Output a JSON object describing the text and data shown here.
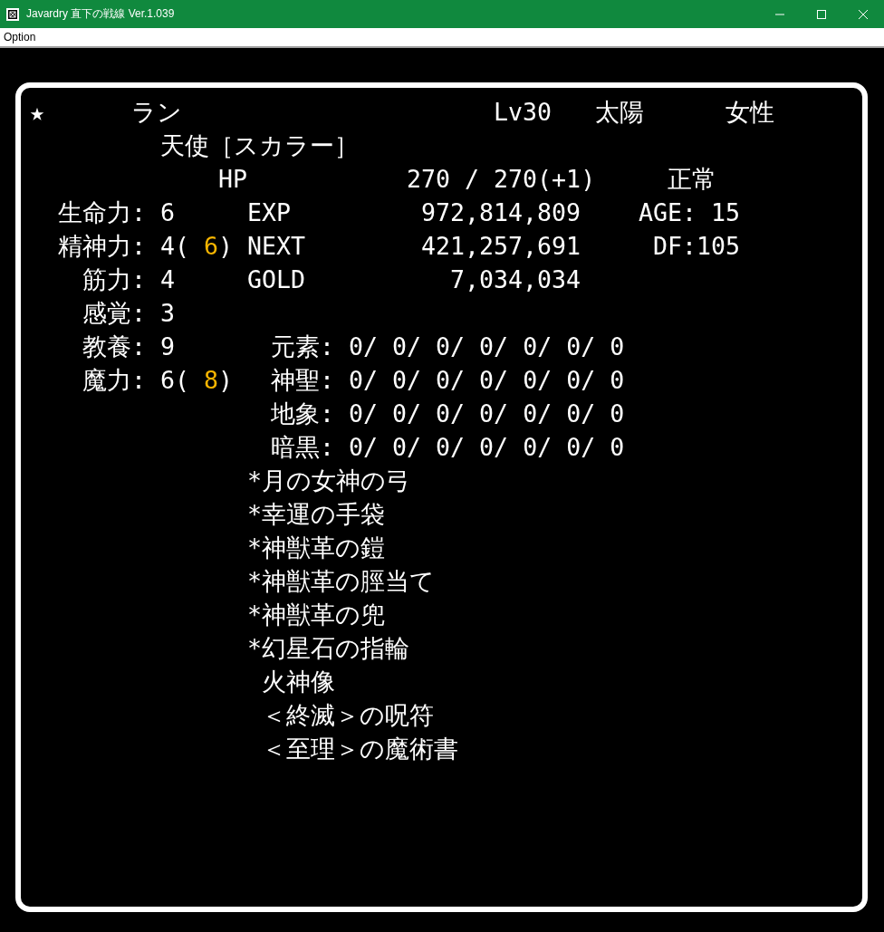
{
  "window": {
    "title": "Javardry 直下の戦線 Ver.1.039"
  },
  "menu": [
    "Option"
  ],
  "character": {
    "mark": "★",
    "name": "ラン",
    "level": "Lv30",
    "alignment": "太陽",
    "sex": "女性",
    "race_class": "天使［スカラー］"
  },
  "hp": {
    "label": "HP",
    "value": "270 / 270(+1)",
    "condition": "正常"
  },
  "stats": [
    {
      "label": "生命力:",
      "parts": [
        {
          "text": "6",
          "highlight": false
        }
      ]
    },
    {
      "label": "精神力:",
      "parts": [
        {
          "text": "4( ",
          "highlight": false
        },
        {
          "text": "6",
          "highlight": true
        },
        {
          "text": ")",
          "highlight": false
        }
      ]
    },
    {
      "label": "筋力:",
      "parts": [
        {
          "text": "4",
          "highlight": false
        }
      ]
    },
    {
      "label": "感覚:",
      "parts": [
        {
          "text": "3",
          "highlight": false
        }
      ]
    },
    {
      "label": "教養:",
      "parts": [
        {
          "text": "9",
          "highlight": false
        }
      ]
    },
    {
      "label": "魔力:",
      "parts": [
        {
          "text": "6( ",
          "highlight": false
        },
        {
          "text": "8",
          "highlight": true
        },
        {
          "text": ")",
          "highlight": false
        }
      ]
    }
  ],
  "records": [
    {
      "label": "EXP",
      "value": "972,814,809"
    },
    {
      "label": "NEXT",
      "value": "421,257,691"
    },
    {
      "label": "GOLD",
      "value": "7,034,034"
    }
  ],
  "age": "AGE: 15",
  "df": "DF:105",
  "resistances": [
    {
      "label": "元素:",
      "values": "0/ 0/ 0/ 0/ 0/ 0/ 0"
    },
    {
      "label": "神聖:",
      "values": "0/ 0/ 0/ 0/ 0/ 0/ 0"
    },
    {
      "label": "地象:",
      "values": "0/ 0/ 0/ 0/ 0/ 0/ 0"
    },
    {
      "label": "暗黒:",
      "values": "0/ 0/ 0/ 0/ 0/ 0/ 0"
    }
  ],
  "items": [
    {
      "mark": "*",
      "name": "月の女神の弓"
    },
    {
      "mark": "*",
      "name": "幸運の手袋"
    },
    {
      "mark": "*",
      "name": "神獣革の鎧"
    },
    {
      "mark": "*",
      "name": "神獣革の脛当て"
    },
    {
      "mark": "*",
      "name": "神獣革の兜"
    },
    {
      "mark": "*",
      "name": "幻星石の指輪"
    },
    {
      "name": "火神像"
    },
    {
      "name": "＜終滅＞の呪符"
    },
    {
      "name": "＜至理＞の魔術書"
    }
  ]
}
